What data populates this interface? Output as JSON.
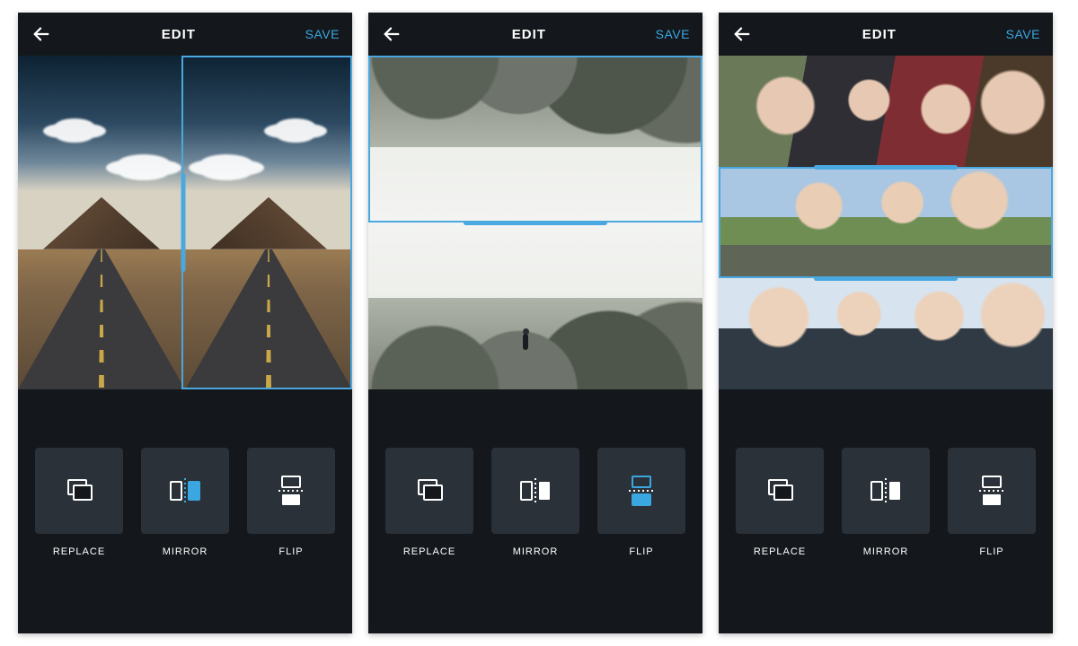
{
  "colors": {
    "accent": "#3aa7e0",
    "bg": "#14181c",
    "tool_bg": "#2a3138"
  },
  "header": {
    "title": "EDIT",
    "save_label": "SAVE"
  },
  "tools": {
    "replace": "REPLACE",
    "mirror": "MIRROR",
    "flip": "FLIP"
  },
  "screens": [
    {
      "active_tool": "mirror",
      "canvas": {
        "layout": "vertical-split",
        "panels": 2,
        "selected_panel": 1
      },
      "photo_hint": "desert highway toward mountain, mirrored"
    },
    {
      "active_tool": "flip",
      "canvas": {
        "layout": "horizontal-split",
        "panels": 2,
        "selected_panel": 0
      },
      "photo_hint": "person jumping over mountain valley, top half flipped"
    },
    {
      "active_tool": "mirror",
      "canvas": {
        "layout": "horizontal-thirds",
        "panels": 3,
        "selected_panel": 1
      },
      "photo_hint": "groups of friends, three stacked photos"
    }
  ]
}
